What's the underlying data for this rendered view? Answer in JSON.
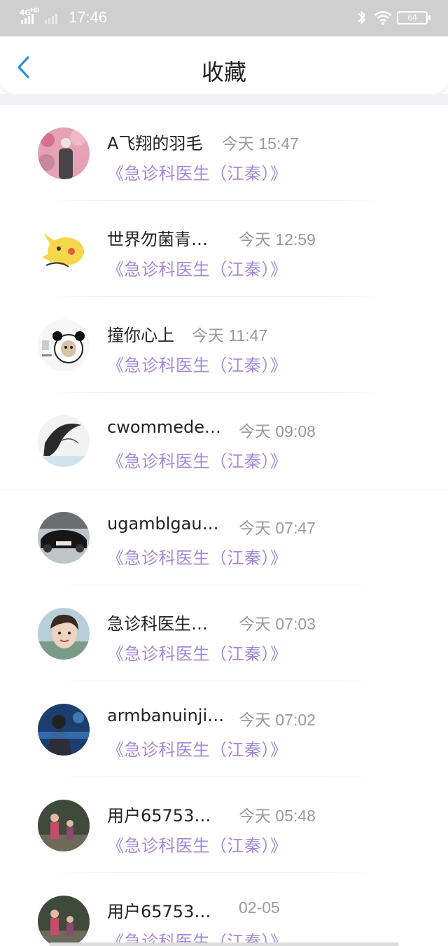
{
  "status_bar": {
    "network": "4G",
    "network_sup": "HD",
    "time": "17:46",
    "battery": "64"
  },
  "header": {
    "title": "收藏"
  },
  "items": [
    {
      "name": "A飞翔的羽毛",
      "time": "今天 15:47",
      "work": "《急诊科医生（江秦）》",
      "avatar": "avatar-flowers"
    },
    {
      "name": "世界勿菌青…",
      "time": "今天 12:59",
      "work": "《急诊科医生（江秦）》",
      "avatar": "avatar-pikachu"
    },
    {
      "name": "撞你心上",
      "time": "今天 11:47",
      "work": "《急诊科医生（江秦）》",
      "avatar": "avatar-panda-meme"
    },
    {
      "name": "cwommede…",
      "time": "今天 09:08",
      "work": "《急诊科医生（江秦）》",
      "avatar": "avatar-girl-sketch"
    },
    {
      "name": "ugamblgau…",
      "time": "今天 07:47",
      "work": "《急诊科医生（江秦）》",
      "avatar": "avatar-black-car"
    },
    {
      "name": "急诊科医生…",
      "time": "今天 07:03",
      "work": "《急诊科医生（江秦）》",
      "avatar": "avatar-girl-photo"
    },
    {
      "name": "armbanuinji…",
      "time": "今天 07:02",
      "work": "《急诊科医生（江秦）》",
      "avatar": "avatar-blue-figure"
    },
    {
      "name": "用户65753…",
      "time": "今天 05:48",
      "work": "《急诊科医生（江秦）》",
      "avatar": "avatar-kids"
    },
    {
      "name": "用户65753…",
      "time": "02-05",
      "work": "《急诊科医生（江秦）》",
      "avatar": "avatar-kids"
    }
  ],
  "colors": {
    "accent": "#2f8fe0",
    "work_link": "#a48ad6",
    "time_text": "#9a9a9a",
    "status_bar_bg": "#cfcfcf"
  }
}
